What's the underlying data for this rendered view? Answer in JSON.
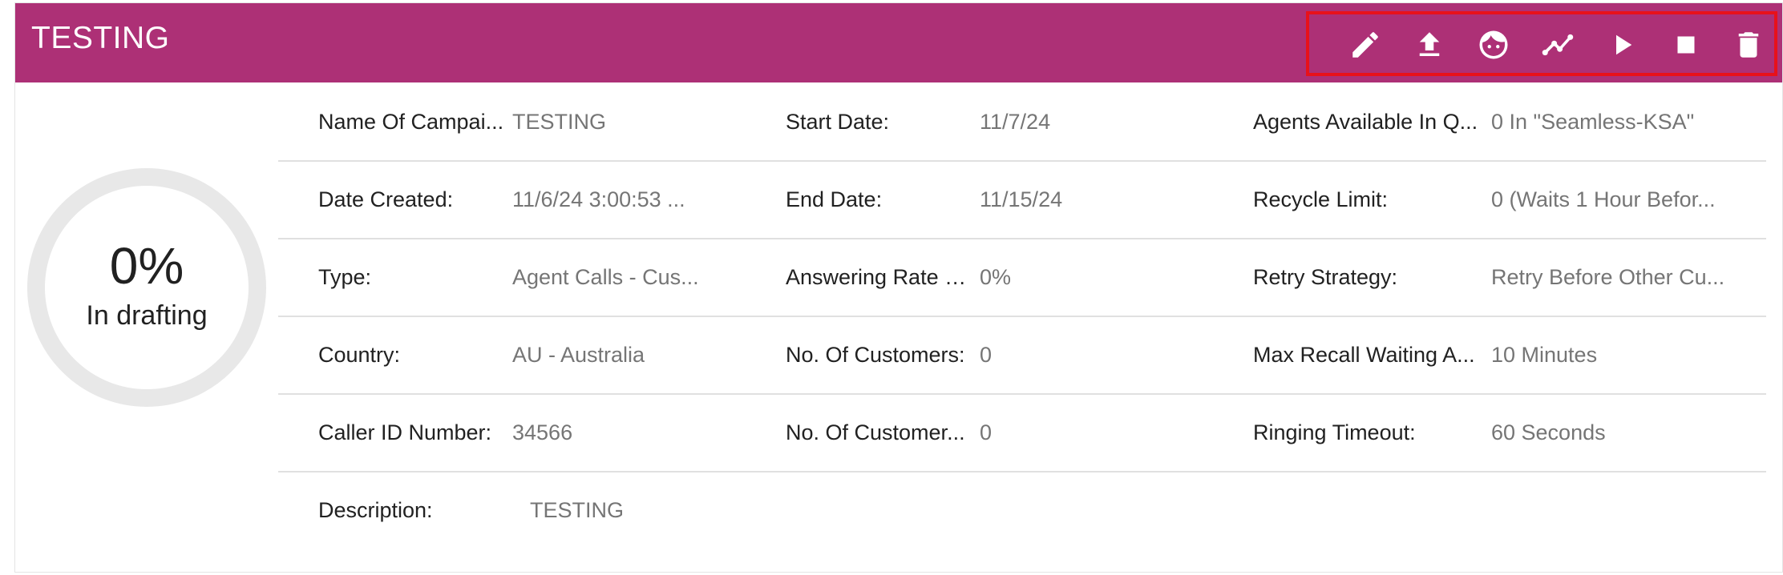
{
  "header": {
    "title": "TESTING"
  },
  "toolbar": {
    "icons": [
      "edit-icon",
      "upload-icon",
      "face-icon",
      "chart-line-icon",
      "play-icon",
      "stop-icon",
      "delete-icon"
    ]
  },
  "progress": {
    "percent_label": "0%",
    "percent": 0,
    "status": "In drafting"
  },
  "details": {
    "rows": [
      [
        {
          "label": "Name Of Campai...",
          "value": "TESTING"
        },
        {
          "label": "Start Date:",
          "value": "11/7/24"
        },
        {
          "label": "Agents Available In Q...",
          "value": "0 In \"Seamless-KSA\""
        }
      ],
      [
        {
          "label": "Date Created:",
          "value": "11/6/24 3:00:53 ..."
        },
        {
          "label": "End Date:",
          "value": "11/15/24"
        },
        {
          "label": "Recycle Limit:",
          "value": "0 (Waits 1 Hour Befor..."
        }
      ],
      [
        {
          "label": "Type:",
          "value": "Agent Calls - Cus..."
        },
        {
          "label": "Answering Rate C...",
          "value": "0%"
        },
        {
          "label": "Retry Strategy:",
          "value": "Retry Before Other Cu..."
        }
      ],
      [
        {
          "label": "Country:",
          "value": "AU - Australia"
        },
        {
          "label": "No. Of Customers:",
          "value": "0"
        },
        {
          "label": "Max Recall Waiting A...",
          "value": "10 Minutes"
        }
      ],
      [
        {
          "label": "Caller ID Number:",
          "value": "34566"
        },
        {
          "label": "No. Of Customer...",
          "value": "0"
        },
        {
          "label": "Ringing Timeout:",
          "value": "60 Seconds"
        }
      ]
    ],
    "description": {
      "label": "Description:",
      "value": "TESTING"
    }
  },
  "colors": {
    "header_bg": "#ad3076",
    "highlight_border": "#e8111a",
    "ring": "#e8e8e8"
  }
}
